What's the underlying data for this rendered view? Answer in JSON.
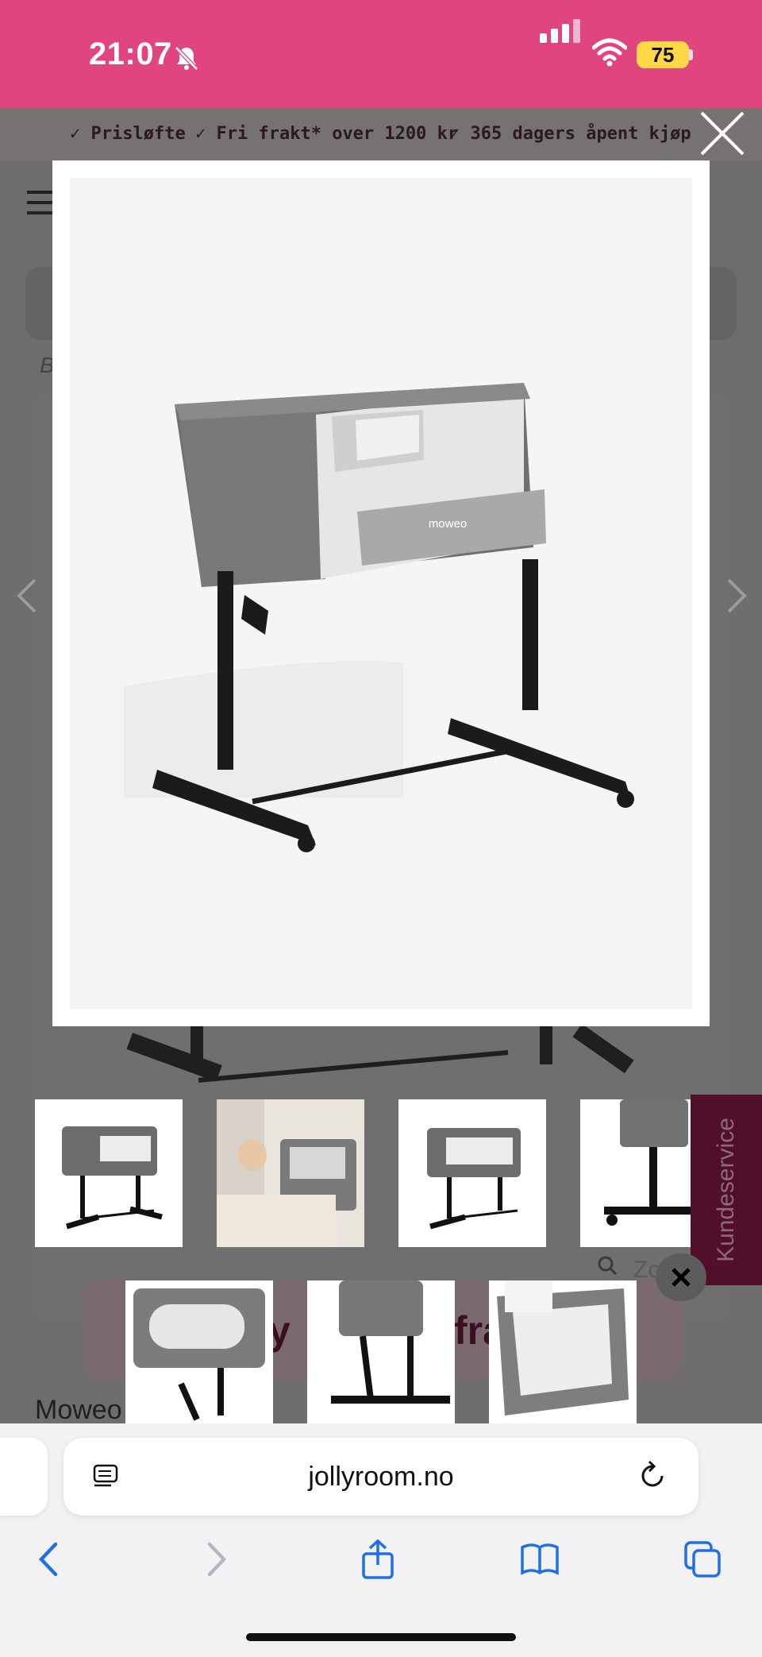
{
  "status_bar": {
    "time": "21:07",
    "battery": "75"
  },
  "usp_bar": {
    "items": [
      "Prisløfte",
      "Fri frakt* over 1200 kr",
      "365 dagers åpent kjøp"
    ]
  },
  "page": {
    "breadcrumb_fragment": "B",
    "customer_service_label": "Kundeservice",
    "zoom_fragment": "Zo",
    "promo_fragment_1": "y",
    "promo_fragment_2": "fra",
    "product_title_fragment": "Moweo"
  },
  "product_image": {
    "brand_on_fabric": "moweo"
  },
  "browser": {
    "url": "jollyroom.no"
  },
  "colors": {
    "status_bar": "#e0457d",
    "customer_service": "#520f29"
  }
}
